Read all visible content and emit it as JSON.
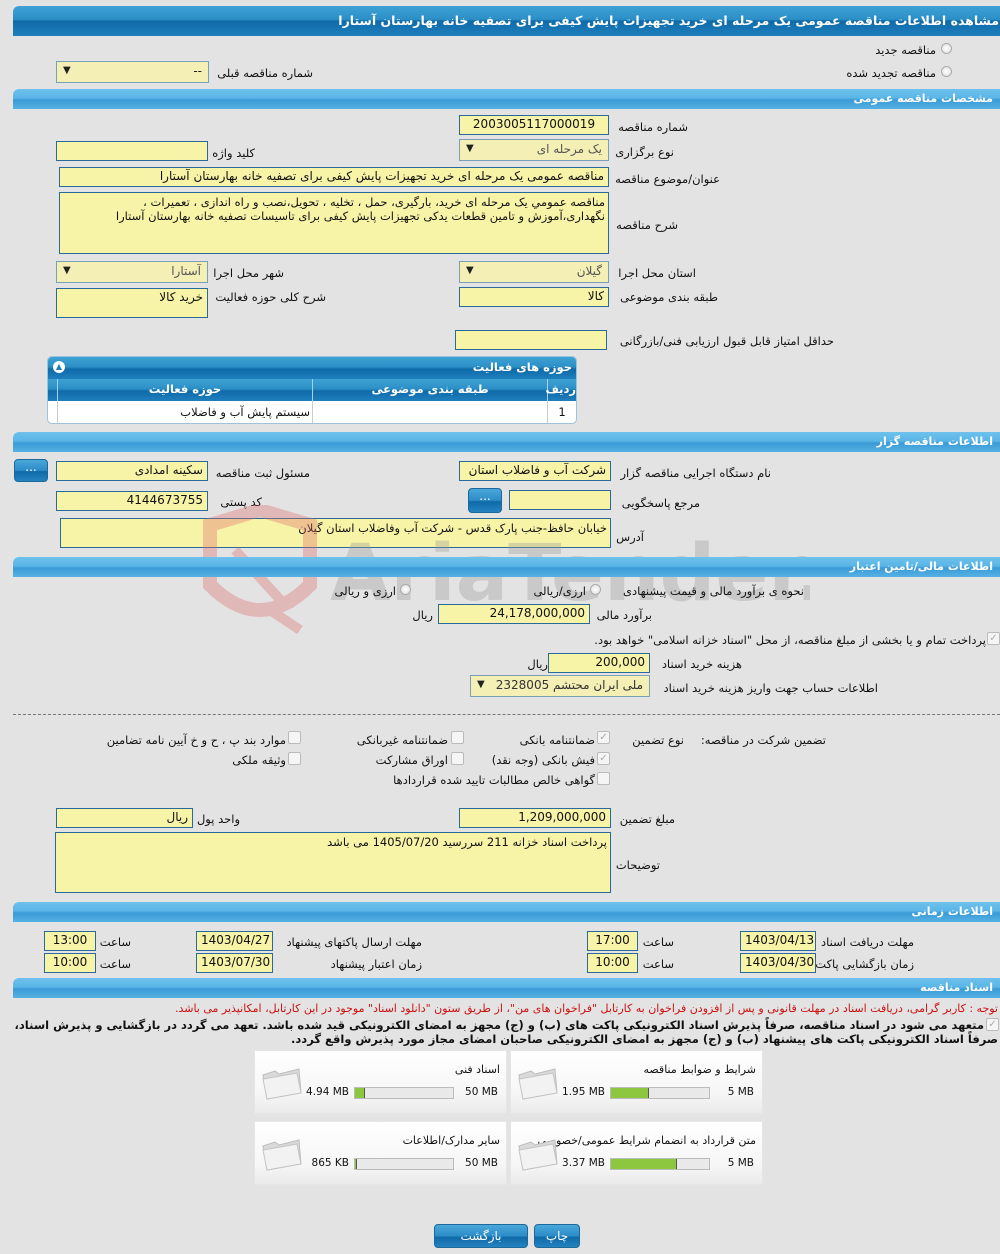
{
  "page_title": "مشاهده اطلاعات مناقصه عمومی یک مرحله ای خرید تجهیزات پایش کیفی برای تصفیه خانه بهارستان آستارا",
  "tender_type": {
    "new_label": "مناقصه جدید",
    "renewed_label": "مناقصه تجدید شده",
    "previous_number_label": "شماره مناقصه قبلی",
    "previous_number_value": "--"
  },
  "general": {
    "section_title": "مشخصات مناقصه عمومی",
    "tender_number_label": "شماره مناقصه",
    "tender_number": "2003005117000019",
    "holding_type_label": "نوع برگزاری",
    "holding_type": "یک مرحله ای",
    "keyword_label": "کلید واژه",
    "keyword": "",
    "subject_label": "عنوان/موضوع مناقصه",
    "subject": "مناقصه عمومی یک مرحله ای خرید تجهیزات پایش کیفی برای تصفیه خانه بهارستان آستارا",
    "description_label": "شرح مناقصه",
    "description_line1": "مناقصه عمومي يک مرحله ای  خرید، بارگیری، حمل ، تخلیه ، تحویل،نصب  و راه اندازی ، تعمیرات ،",
    "description_line2": "نگهداری،آموزش و تامین قطعات یدکی تجهیزات پایش کیفی برای تاسیسات تصفیه خانه بهارستان آستارا",
    "province_label": "استان محل اجرا",
    "province": "گیلان",
    "city_label": "شهر محل اجرا",
    "city": "آستارا",
    "category_label": "طبقه بندی موضوعی",
    "category": "کالا",
    "activity_scope_label": "شرح کلی حوزه فعالیت",
    "activity_scope": "خرید کالا",
    "min_score_label": "حداقل امتیاز قابل قبول ارزیابی فنی/بازرگانی",
    "min_score": ""
  },
  "activity_grid": {
    "title": "حوزه های فعالیت",
    "columns": [
      "ردیف",
      "طبقه بندی موضوعی",
      "حوزه فعالیت"
    ],
    "rows": [
      {
        "row": "1",
        "category": "",
        "activity": "سیستم پایش آب و فاضلاب"
      }
    ]
  },
  "organizer": {
    "section_title": "اطلاعات مناقصه گزار",
    "org_name_label": "نام دستگاه اجرایی مناقصه گزار",
    "org_name": "شرکت آب و فاضلاب استان",
    "registrar_label": "مسئول ثبت مناقصه",
    "registrar": "سکینه امدادی",
    "reference_label": "مرجع پاسخگویی",
    "reference": "",
    "postal_code_label": "کد پستی",
    "postal_code": "4144673755",
    "address_label": "آدرس",
    "address": "خیابان حافظ-جنب پارک قدس - شرکت آب وفاضلاب استان گیلان",
    "more_button": "..."
  },
  "financial": {
    "section_title": "اطلاعات مالی/تامین اعتبار",
    "estimate_method_label": "نحوه ی برآورد مالی و قیمت پیشنهادی",
    "option_rial": "ارزی/ریالی",
    "option_fx_rial": "ارزی و ریالی",
    "estimate_label": "برآورد مالی",
    "estimate": "24,178,000,000",
    "currency": "ریال",
    "treasury_note": "پرداخت تمام و یا بخشی از مبلغ مناقصه، از محل \"اسناد خزانه اسلامی\" خواهد بود.",
    "doc_fee_label": "هزینه خرید اسناد",
    "doc_fee": "200,000",
    "account_label": "اطلاعات حساب جهت واریز هزینه خرید اسناد",
    "account": "ملی ایران محتشم 2328005"
  },
  "guarantee": {
    "title": "تضمین شرکت در مناقصه:",
    "type_label": "نوع تضمین",
    "options": [
      {
        "label": "ضمانتنامه بانکی",
        "checked": true
      },
      {
        "label": "ضمانتنامه غیربانکی",
        "checked": false
      },
      {
        "label": "موارد بند پ ، ح و خ آیین نامه تضامین",
        "checked": false
      },
      {
        "label": "فیش بانکی (وجه نقد)",
        "checked": true
      },
      {
        "label": "اوراق مشارکت",
        "checked": false
      },
      {
        "label": "وثیقه ملکی",
        "checked": false
      },
      {
        "label": "گواهی خالص مطالبات تایید شده قراردادها",
        "checked": false
      }
    ],
    "amount_label": "مبلغ تضمین",
    "amount": "1,209,000,000",
    "currency_label": "واحد پول",
    "currency": "ریال",
    "notes_label": "توضیحات",
    "notes": "پرداخت اسناد خزانه 211 سررسید 1405/07/20 می باشد"
  },
  "timing": {
    "section_title": "اطلاعات زمانی",
    "doc_deadline_label": "مهلت دریافت اسناد",
    "doc_deadline_date": "1403/04/13",
    "doc_deadline_time": "17:00",
    "submit_deadline_label": "مهلت ارسال پاکتهای پیشنهاد",
    "submit_deadline_date": "1403/04/27",
    "submit_deadline_time": "13:00",
    "opening_label": "زمان بازگشایی پاکت ها",
    "opening_date": "1403/04/30",
    "opening_time": "10:00",
    "validity_label": "زمان اعتبار پیشنهاد",
    "validity_date": "1403/07/30",
    "validity_time": "10:00",
    "time_label": "ساعت"
  },
  "documents": {
    "section_title": "اسناد مناقصه",
    "notice": "توجه : کاربر گرامی، دریافت اسناد در مهلت قانونی و پس از افزودن فراخوان به کارتابل \"فراخوان های من\"، از طریق ستون \"دانلود اسناد\" موجود در این کارتابل، امکانپذیر می باشد.",
    "commitment_line1": "متعهد می شود در اسناد مناقصه، صرفاً پذیرش اسناد الکترونیکی پاکت های (ب) و (ج) مجهز به امضای الکترونیکی قید شده باشد. تعهد می گردد در بازگشایی و پذیرش اسناد،",
    "commitment_line2": "صرفاً اسناد الکترونیکی پاکت های پیشنهاد (ب) و (ج) مجهز به امضای الکترونیکی صاحبان امضای مجاز مورد پذیرش واقع گردد.",
    "items": [
      {
        "title": "شرایط و ضوابط مناقصه",
        "used": "1.95 MB",
        "max": "5 MB",
        "fraction": 0.39
      },
      {
        "title": "اسناد فنی",
        "used": "4.94 MB",
        "max": "50 MB",
        "fraction": 0.0988
      },
      {
        "title": "متن قرارداد به انضمام شرایط عمومی/خصوصی",
        "used": "3.37 MB",
        "max": "5 MB",
        "fraction": 0.674
      },
      {
        "title": "سایر مدارک/اطلاعات",
        "used": "865 KB",
        "max": "50 MB",
        "fraction": 0.017
      }
    ]
  },
  "footer": {
    "print_label": "چاپ",
    "back_label": "بازگشت"
  },
  "watermark": "AriaTender.neT"
}
